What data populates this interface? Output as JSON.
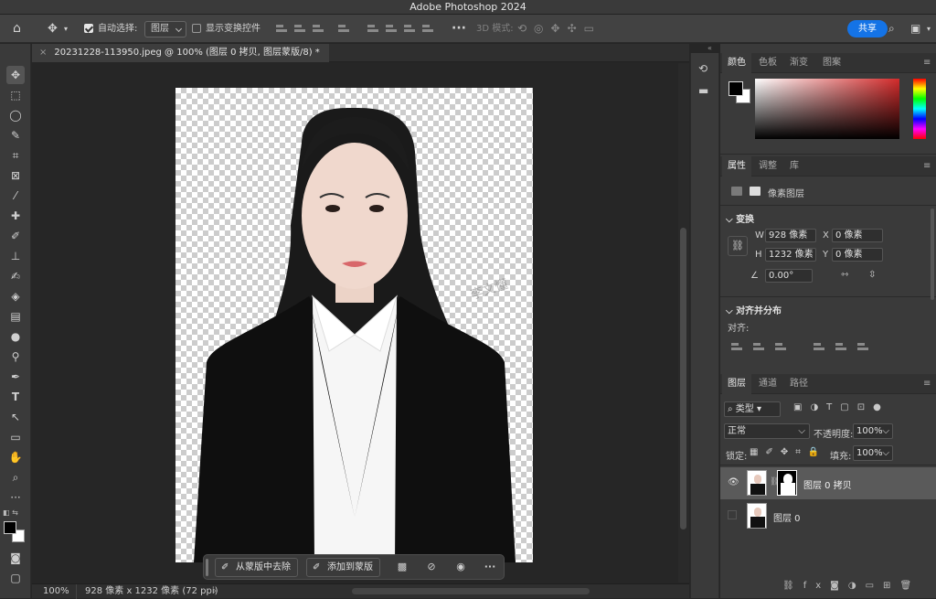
{
  "app_title": "Adobe Photoshop 2024",
  "options_bar": {
    "auto_select_label": "自动选择:",
    "auto_select_value": "图层",
    "show_transform_label": "显示变换控件",
    "mode_3d_label": "3D 模式:",
    "share_label": "共享"
  },
  "document": {
    "tab_title": "20231228-113950.jpeg @ 100% (图层 0 拷贝, 图层蒙版/8) *",
    "watermark": "李文懂"
  },
  "status": {
    "zoom": "100%",
    "dimensions": "928 像素 x 1232 像素 (72 ppi)"
  },
  "context_bar": {
    "remove_from_mask": "从蒙版中去除",
    "add_to_mask": "添加到蒙版"
  },
  "color_panel": {
    "tabs": [
      "颜色",
      "色板",
      "渐变",
      "图案"
    ],
    "hue_color": "#d32b2b"
  },
  "properties_panel": {
    "tabs": [
      "属性",
      "调整",
      "库"
    ],
    "layer_type": "像素图层",
    "transform_title": "变换",
    "w_label": "W",
    "w_value": "928 像素",
    "h_label": "H",
    "h_value": "1232 像素",
    "x_label": "X",
    "x_value": "0 像素",
    "y_label": "Y",
    "y_value": "0 像素",
    "angle_value": "0.00°",
    "align_title": "对齐并分布",
    "align_label": "对齐:"
  },
  "layers_panel": {
    "tabs": [
      "图层",
      "通道",
      "路径"
    ],
    "filter_label": "类型",
    "blend_mode": "正常",
    "opacity_label": "不透明度:",
    "opacity_value": "100%",
    "lock_label": "锁定:",
    "fill_label": "填充:",
    "fill_value": "100%",
    "layers": [
      {
        "name": "图层 0 拷贝",
        "visible": true,
        "selected": true,
        "has_mask": true
      },
      {
        "name": "图层 0",
        "visible": false,
        "selected": false,
        "has_mask": false
      }
    ]
  }
}
